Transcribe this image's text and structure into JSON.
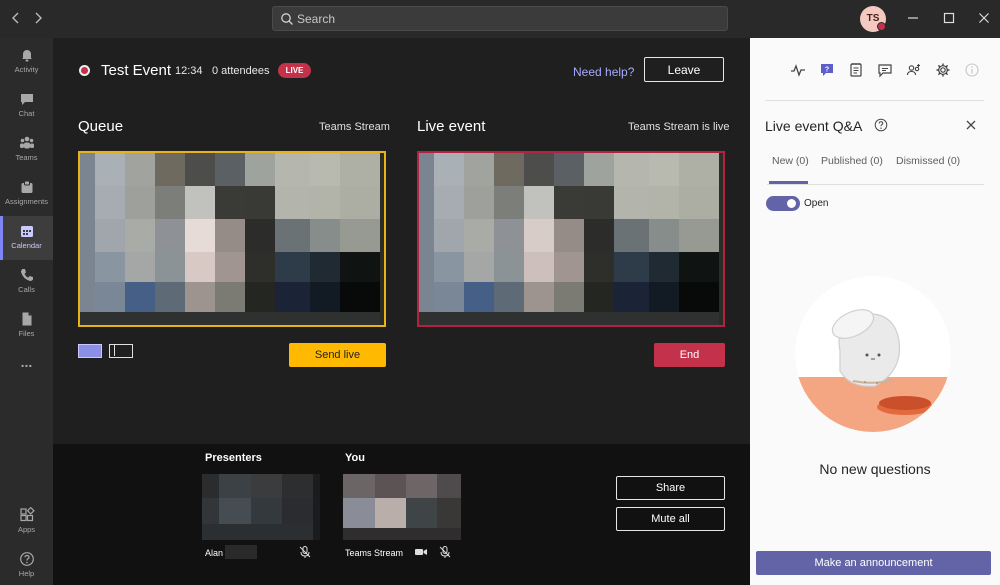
{
  "titlebar": {
    "search_placeholder": "Search",
    "avatar_initials": "TS"
  },
  "rail": {
    "items": [
      {
        "label": "Activity",
        "icon": "bell-icon"
      },
      {
        "label": "Chat",
        "icon": "chat-icon"
      },
      {
        "label": "Teams",
        "icon": "teams-icon"
      },
      {
        "label": "Assignments",
        "icon": "assignments-icon"
      },
      {
        "label": "Calendar",
        "icon": "calendar-icon",
        "active": true
      },
      {
        "label": "Calls",
        "icon": "phone-icon"
      },
      {
        "label": "Files",
        "icon": "file-icon"
      }
    ],
    "more": "...",
    "apps_label": "Apps",
    "help_label": "Help"
  },
  "event": {
    "title": "Test Event",
    "time": "12:34",
    "attendees": "0 attendees",
    "live_badge": "LIVE",
    "need_help": "Need help?",
    "leave_label": "Leave"
  },
  "queue": {
    "title": "Queue",
    "source": "Teams Stream",
    "send_live_label": "Send live"
  },
  "live_event": {
    "title": "Live event",
    "status": "Teams Stream is live",
    "end_label": "End"
  },
  "presenters": {
    "title": "Presenters",
    "name": "Alan"
  },
  "you": {
    "title": "You",
    "name": "Teams Stream"
  },
  "controls": {
    "share_label": "Share",
    "mute_all_label": "Mute all"
  },
  "qa": {
    "title": "Live event Q&A",
    "tabs": [
      {
        "label": "New (0)",
        "active": true
      },
      {
        "label": "Published (0)"
      },
      {
        "label": "Dismissed (0)"
      }
    ],
    "toggle_label": "Open",
    "empty_text": "No new questions",
    "announce_label": "Make an announcement"
  },
  "colors": {
    "accent": "#6264a7",
    "live": "#c4314b",
    "queue_border": "#e8b21a",
    "send_live": "#ffb900"
  }
}
